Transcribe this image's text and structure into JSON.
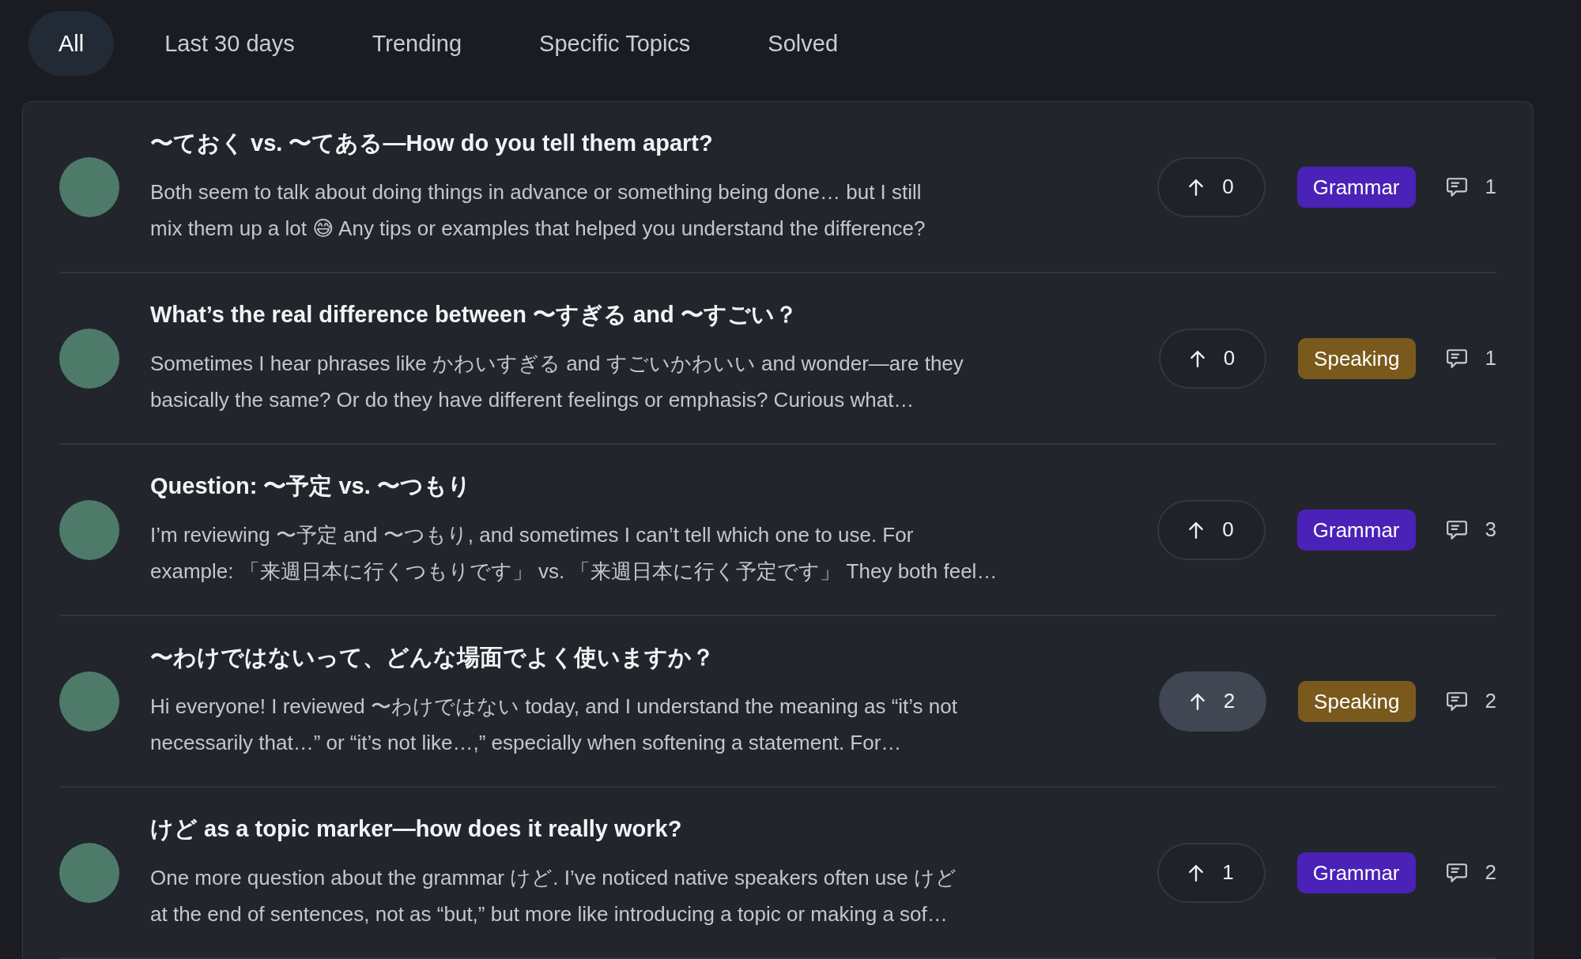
{
  "tabs": [
    {
      "label": "All",
      "selected": true
    },
    {
      "label": "Last 30 days",
      "selected": false
    },
    {
      "label": "Trending",
      "selected": false
    },
    {
      "label": "Specific Topics",
      "selected": false
    },
    {
      "label": "Solved",
      "selected": false
    }
  ],
  "posts": [
    {
      "title": "〜ておく vs. 〜てある—How do you tell them apart?",
      "body_lines": [
        "Both seem to talk about doing things in advance or something being done… but I still",
        "mix them up a lot 😅 Any tips or examples that helped you understand the difference?"
      ],
      "votes": "0",
      "voted": false,
      "tag": {
        "label": "Grammar",
        "color": "#4a22b8"
      },
      "comments": "1"
    },
    {
      "title": "What’s the real difference between 〜すぎる and 〜すごい？",
      "body_lines": [
        "Sometimes I hear phrases like かわいすぎる and すごいかわいい and wonder—are they",
        "basically the same? Or do they have different feelings or emphasis? Curious what…"
      ],
      "votes": "0",
      "voted": false,
      "tag": {
        "label": "Speaking",
        "color": "#7a5a1c"
      },
      "comments": "1"
    },
    {
      "title": "Question: 〜予定 vs. 〜つもり",
      "body_lines": [
        "I’m reviewing 〜予定 and 〜つもり, and sometimes I can’t tell which one to use. For",
        "example: 「来週日本に行くつもりです」 vs. 「来週日本に行く予定です」 They both feel…"
      ],
      "votes": "0",
      "voted": false,
      "tag": {
        "label": "Grammar",
        "color": "#4a22b8"
      },
      "comments": "3"
    },
    {
      "title": "〜わけではないって、どんな場面でよく使いますか？",
      "body_lines": [
        "Hi everyone! I reviewed 〜わけではない today, and I understand the meaning as “it’s not",
        "necessarily that…” or “it’s not like…,” especially when softening a statement. For…"
      ],
      "votes": "2",
      "voted": true,
      "tag": {
        "label": "Speaking",
        "color": "#7a5a1c"
      },
      "comments": "2"
    },
    {
      "title": "けど as a topic marker—how does it really work?",
      "body_lines": [
        "One more question about the grammar けど. I’ve noticed native speakers often use けど",
        "at the end of sentences, not as “but,” but more like introducing a topic or making a sof…"
      ],
      "votes": "1",
      "voted": false,
      "tag": {
        "label": "Grammar",
        "color": "#4a22b8"
      },
      "comments": "2"
    }
  ]
}
